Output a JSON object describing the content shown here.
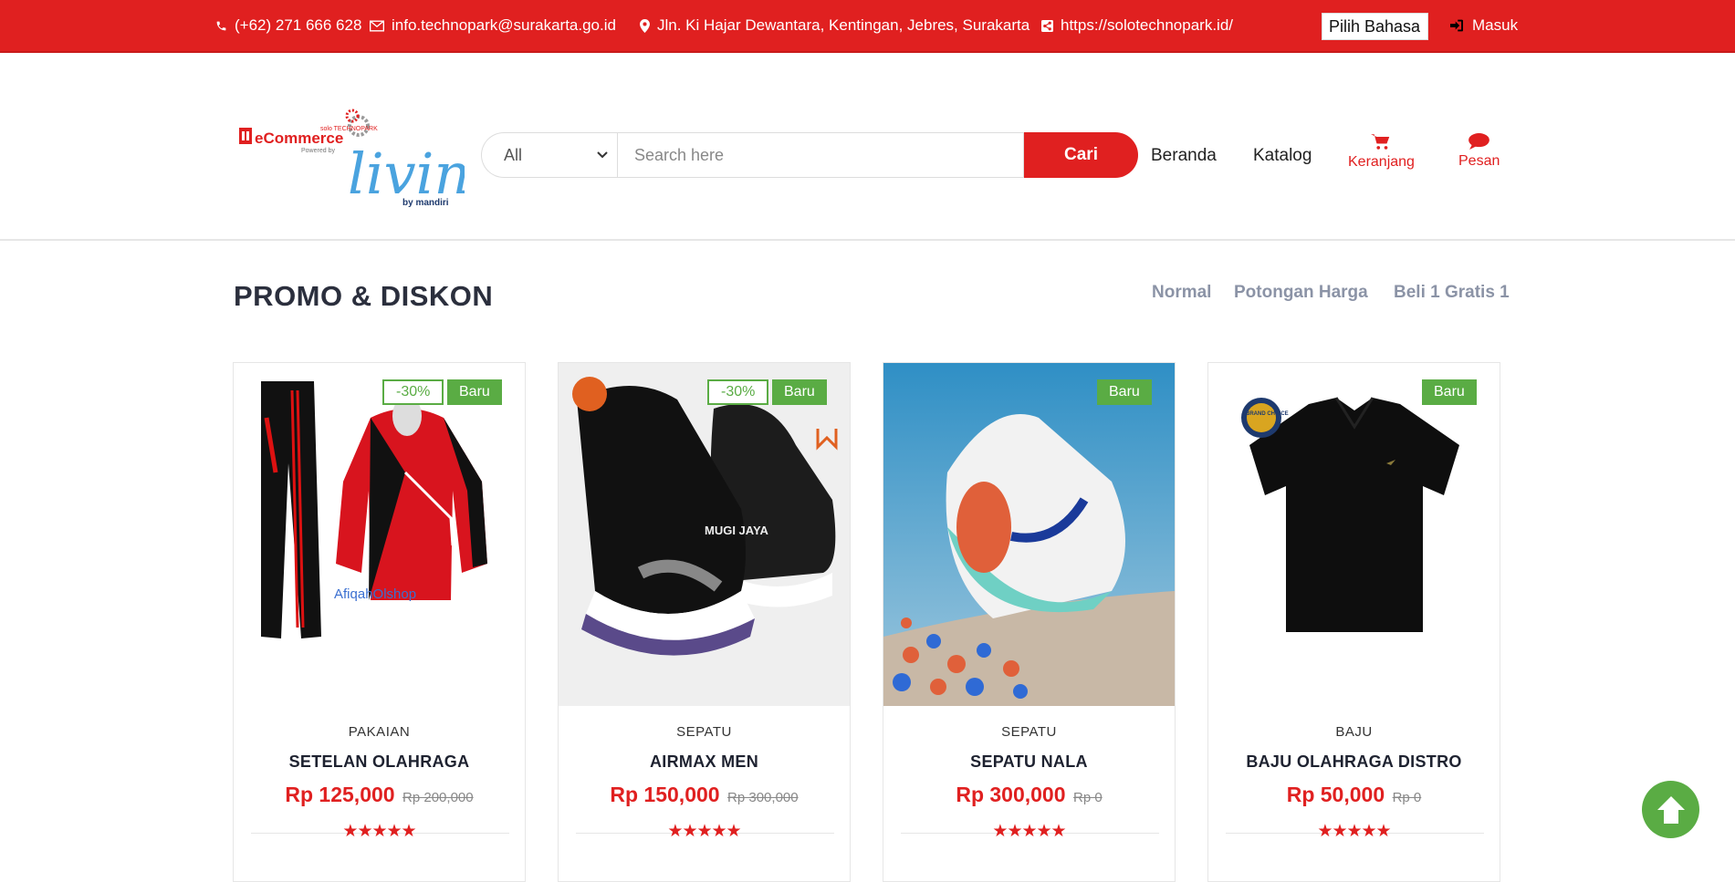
{
  "topbar": {
    "phone": "(+62) 271 666 628",
    "email": "info.technopark@surakarta.go.id",
    "address": "Jln. Ki Hajar Dewantara, Kentingan, Jebres, Surakarta",
    "website": "https://solotechnopark.id/",
    "language_select": "Pilih Bahasa",
    "login": "Masuk"
  },
  "logo": {
    "brand": "eCommerce",
    "powered_by": "Powered by",
    "partner": "livin'",
    "partner_sub": "by mandiri",
    "small_tag": "solo TECHNOPARK"
  },
  "search": {
    "category": "All",
    "placeholder": "Search here",
    "button": "Cari"
  },
  "nav": {
    "home": "Beranda",
    "catalog": "Katalog",
    "cart": "Keranjang",
    "messages": "Pesan"
  },
  "section": {
    "title": "PROMO & DISKON",
    "filters": [
      "Normal",
      "Potongan Harga",
      "Beli 1 Gratis 1"
    ]
  },
  "products": [
    {
      "category": "PAKAIAN",
      "name": "SETELAN OLAHRAGA",
      "price": "Rp 125,000",
      "old_price": "Rp 200,000",
      "discount": "-30%",
      "badge": "Baru",
      "rating": 5,
      "image_text": "AfiqahOlshop"
    },
    {
      "category": "SEPATU",
      "name": "AIRMAX MEN",
      "price": "Rp 150,000",
      "old_price": "Rp 300,000",
      "discount": "-30%",
      "badge": "Baru",
      "rating": 5,
      "image_text": "MUGI JAYA"
    },
    {
      "category": "SEPATU",
      "name": "SEPATU NALA",
      "price": "Rp 300,000",
      "old_price": "Rp 0",
      "badge": "Baru",
      "rating": 5
    },
    {
      "category": "BAJU",
      "name": "BAJU OLAHRAGA DISTRO",
      "price": "Rp 50,000",
      "old_price": "Rp 0",
      "badge": "Baru",
      "rating": 5,
      "image_text": "BRAND CHOICE"
    }
  ],
  "colors": {
    "primary": "#e02020",
    "accent": "#5aac44",
    "title": "#2b2f3d",
    "muted": "#8b93a6"
  }
}
